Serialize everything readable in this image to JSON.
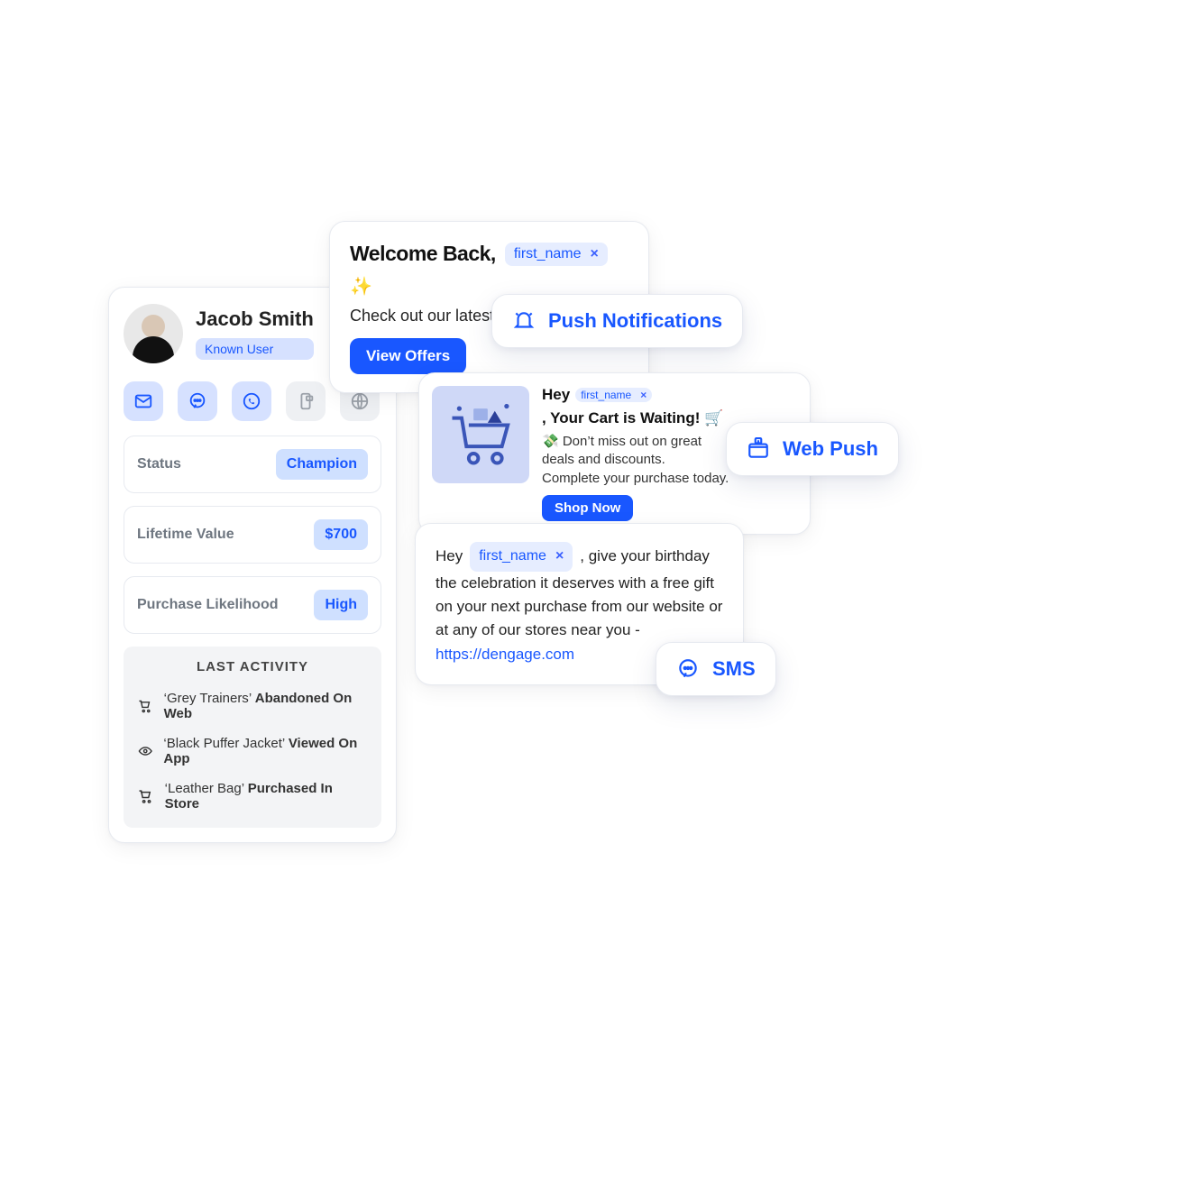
{
  "profile": {
    "name": "Jacob Smith",
    "user_type": "Known User",
    "channels": [
      "email",
      "chat",
      "whatsapp",
      "device",
      "web"
    ],
    "fields": [
      {
        "label": "Status",
        "value": "Champion"
      },
      {
        "label": "Lifetime Value",
        "value": "$700"
      },
      {
        "label": "Purchase Likelihood",
        "value": "High"
      }
    ],
    "activity_title": "LAST ACTIVITY",
    "activity": [
      {
        "icon": "cart",
        "product": "Grey Trainers",
        "action": "Abandoned On Web"
      },
      {
        "icon": "eye",
        "product": "Black Puffer Jacket",
        "action": "Viewed On App"
      },
      {
        "icon": "cart",
        "product": "Leather Bag",
        "action": "Purchased In Store"
      }
    ]
  },
  "welcome": {
    "title_prefix": "Welcome Back,",
    "variable": "first_name",
    "sparkle": "✨",
    "subtitle": "Check out our latest offers!",
    "cta": "View Offers"
  },
  "push_pill": {
    "label": "Push Notifications"
  },
  "cart_card": {
    "title_prefix": "Hey",
    "variable": "first_name",
    "title_suffix": ", Your Cart is Waiting! 🛒",
    "line1": "💸 Don’t miss out on great",
    "line2": "deals and discounts.",
    "line3": "Complete your purchase today.",
    "cta": "Shop Now"
  },
  "webpush_pill": {
    "label": "Web Push"
  },
  "birthday_card": {
    "prefix": "Hey",
    "variable": "first_name",
    "line1_suffix": ", give your birthday",
    "line2": "the celebration it deserves with a free gift",
    "line3": "on your next purchase from our website or",
    "line4": "at any of our stores near you -",
    "link_text": "https://dengage.com"
  },
  "sms_pill": {
    "label": "SMS"
  }
}
